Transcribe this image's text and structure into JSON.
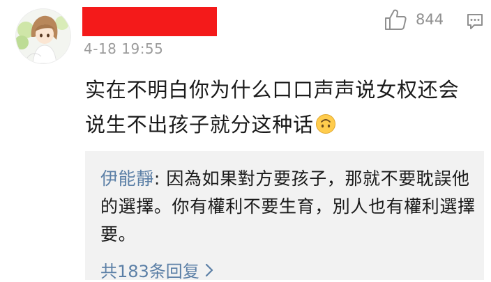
{
  "comment": {
    "timestamp": "4-18 19:55",
    "like_count": "844",
    "text": "实在不明白你为什么口口声声说女权还会说生不出孩子就分这种话",
    "emoji": "upside-down-smiley"
  },
  "reply": {
    "author": "伊能靜",
    "separator": ": ",
    "text": "因為如果對方要孩子，那就不要耽誤他的選擇。你有權利不要生育，別人也有權利選擇要。"
  },
  "more_replies": {
    "label": "共183条回复"
  },
  "colors": {
    "link": "#5b7fa6",
    "redaction": "#f41a1a",
    "reply_bg": "#f2f2f2",
    "meta_gray": "#9b9b9b"
  },
  "icons": {
    "like": "thumbs-up-icon",
    "comment": "comment-bubble-icon",
    "more": "chevron-right-icon"
  }
}
